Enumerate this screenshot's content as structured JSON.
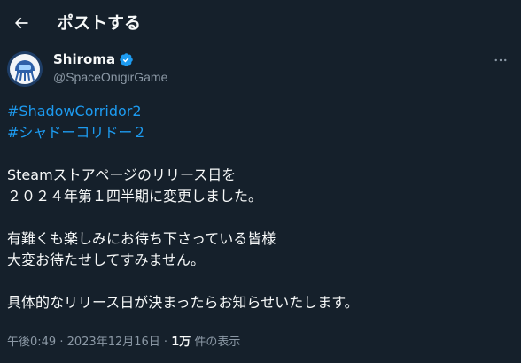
{
  "header": {
    "back_icon": "arrow-left-icon",
    "title": "ポストする"
  },
  "author": {
    "display_name": "Shiroma",
    "handle": "@SpaceOnigirGame",
    "verified_icon": "verified-badge-icon",
    "avatar_icon": "space-onigiri-avatar"
  },
  "more_icon": "ellipsis-icon",
  "tweet": {
    "hashtags": [
      "#ShadowCorridor2",
      "#シャドーコリドー２"
    ],
    "lines": [
      "Steamストアページのリリース日を",
      "２０２４年第１四半期に変更しました。",
      "",
      "有難くも楽しみにお待ち下さっている皆様",
      "大変お待たせしてすみません。",
      "",
      "具体的なリリース日が決まったらお知らせいたします。"
    ]
  },
  "meta": {
    "time": "午後0:49",
    "separator": " · ",
    "date": "2023年12月16日",
    "views_count": "1万",
    "views_label": " 件の表示"
  },
  "colors": {
    "background": "#15202b",
    "text": "#f7f9f9",
    "secondary": "#8b98a5",
    "accent": "#1d9bf0"
  }
}
